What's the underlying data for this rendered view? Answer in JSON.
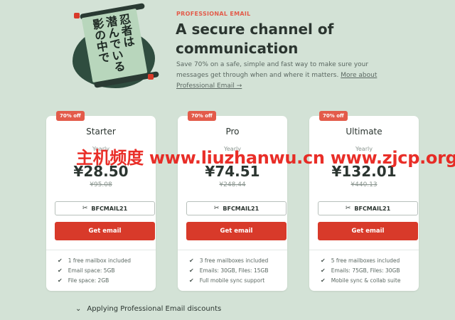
{
  "header": {
    "eyebrow": "PROFESSIONAL EMAIL",
    "headline_line1": "A secure channel of",
    "headline_line2": "communication",
    "lead_text": "Save 70% on a safe, simple and fast way to make sure your messages get through when and where it matters. ",
    "lead_link": "More about Professional Email →"
  },
  "illustration": {
    "scroll_columns": [
      "忍者は",
      "潜んでいる",
      "影の中で"
    ]
  },
  "colors": {
    "accent": "#d83a2a",
    "badge": "#e35b4a",
    "background": "#d3e2d6"
  },
  "plans": [
    {
      "badge": "70% off",
      "name": "Starter",
      "cycle": "Yearly",
      "price": "¥28.50",
      "old_price": "¥95.08",
      "coupon": "BFCMAIL21",
      "cta": "Get email",
      "features": [
        "1 free mailbox included",
        "Email space: 5GB",
        "File space: 2GB"
      ]
    },
    {
      "badge": "70% off",
      "name": "Pro",
      "cycle": "Yearly",
      "price": "¥74.51",
      "old_price": "¥248.44",
      "coupon": "BFCMAIL21",
      "cta": "Get email",
      "features": [
        "3 free mailboxes included",
        "Emails: 30GB, Files: 15GB",
        "Full mobile sync support"
      ]
    },
    {
      "badge": "70% off",
      "name": "Ultimate",
      "cycle": "Yearly",
      "price": "¥132.01",
      "old_price": "¥440.13",
      "coupon": "BFCMAIL21",
      "cta": "Get email",
      "features": [
        "5 free mailboxes included",
        "Emails: 75GB, Files: 30GB",
        "Mobile sync & collab suite"
      ]
    }
  ],
  "icons": {
    "coupon": "scissors-icon",
    "check": "check-icon",
    "expand": "chevron-down-icon"
  },
  "footer": {
    "discounts_label": "Applying Professional Email discounts"
  },
  "watermark": {
    "text": "主机频度 www.liuzhanwu.cn  www.zjcp.org"
  }
}
